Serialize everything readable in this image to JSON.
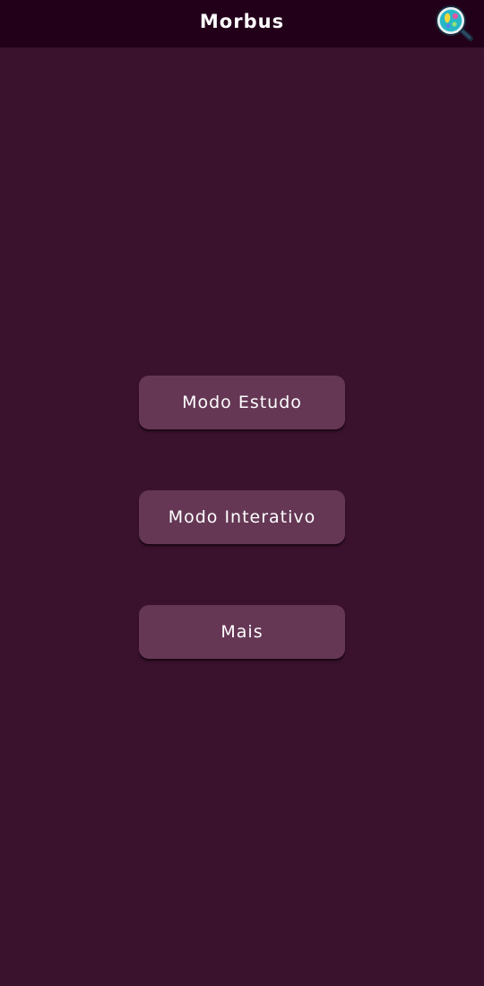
{
  "app": {
    "title": "Morbus",
    "logo_icon": "magnifier-virus-icon"
  },
  "menu": {
    "buttons": [
      {
        "label": "Modo Estudo"
      },
      {
        "label": "Modo Interativo"
      },
      {
        "label": "Mais"
      }
    ]
  },
  "colors": {
    "background": "#3b122e",
    "topbar": "#23001a",
    "button": "#653755",
    "text": "#ffffff"
  }
}
